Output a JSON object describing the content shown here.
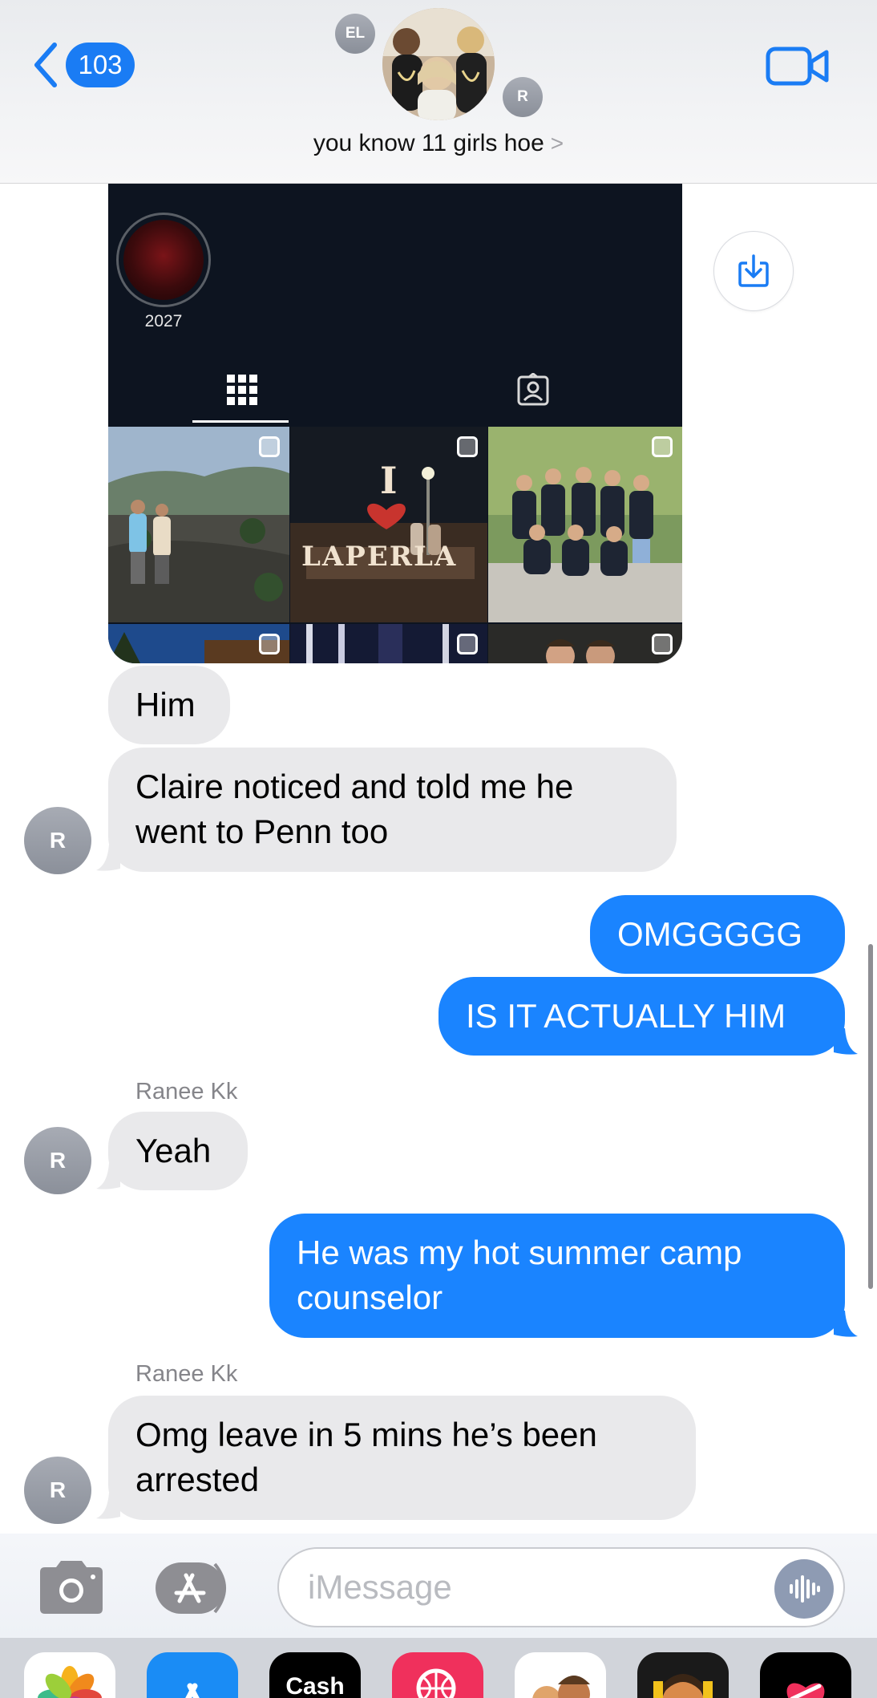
{
  "header": {
    "back_count": "103",
    "title": "you know 11 girls hoe",
    "title_chevron": ">",
    "member_initials_left": "EL",
    "member_initials_right": "R"
  },
  "shared_post": {
    "story_label": "2027",
    "tile_sign_top": "I",
    "tile_sign_text": "LAPERLA"
  },
  "messages": [
    {
      "direction": "in",
      "text": "Him"
    },
    {
      "direction": "in",
      "text": "Claire noticed and told me he went to Penn too",
      "avatar": "R"
    },
    {
      "direction": "out",
      "text": "OMGGGGG"
    },
    {
      "direction": "out",
      "text": "IS IT ACTUALLY HIM"
    },
    {
      "direction": "in",
      "sender": "Ranee Kk",
      "text": "Yeah",
      "avatar": "R"
    },
    {
      "direction": "out",
      "text": "He was my hot summer camp counselor"
    },
    {
      "direction": "in",
      "sender": "Ranee Kk",
      "text": "Omg leave in 5 mins he’s been arrested",
      "avatar": "R"
    }
  ],
  "input": {
    "placeholder": "iMessage"
  },
  "drawer": {
    "cash_label": "Cash"
  },
  "colors": {
    "accent_blue": "#1a84ff",
    "incoming_gray": "#e9e9eb"
  }
}
